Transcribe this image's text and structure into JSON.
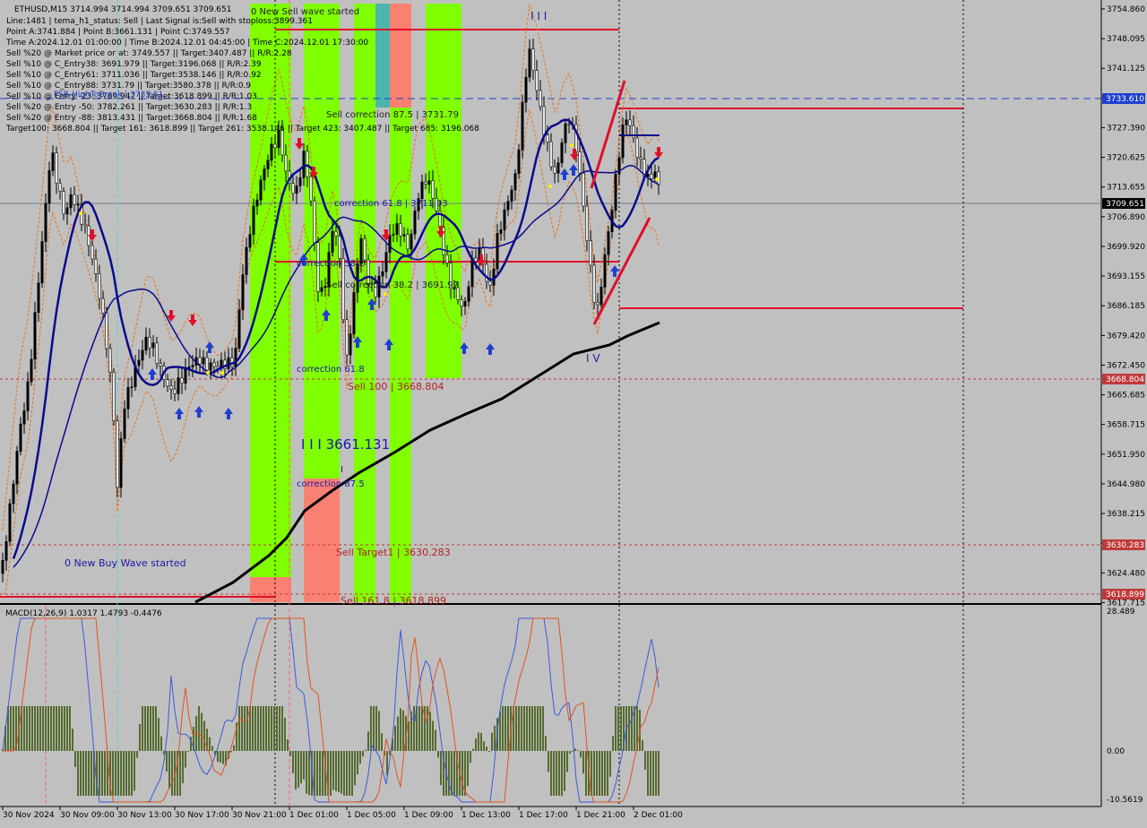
{
  "header": {
    "symbol_line": "ETHUSD,M15  3714.994 3714.994 3709.651 3709.651",
    "info_lines": [
      "Line:1481  |  tema_h1_status: Sell  |  Last Signal is:Sell with stoploss:3899.361",
      "Point A:3741.884  |  Point B:3661.131  |  Point C:3749.557",
      "Time A:2024.12.01 01:00:00  |  Time B:2024.12.01 04:45:00  |  Time C:2024.12.01 17:30:00",
      "Sell %20 @ Market price or at: 3749.557  ||  Target:3407.487  ||  R/R:2.28",
      "Sell %10 @ C_Entry38: 3691.979  ||  Target:3196.068  ||  R/R:2.39",
      "Sell %10 @ C_Entry61: 3711.036  ||  Target:3538.146  ||  R/R:0.92",
      "Sell %10 @ C_Entry88: 3731.79  ||  Target:3580.378  ||  R/R:0.9",
      "Sell %10 @ Entry -23: 3769.947  ||  Target:3618.899  ||  R/R:1.03",
      "Sell %20 @ Entry -50: 3782.261  ||  Target:3630.283  ||  R/R:1.3",
      "Sell %20 @ Entry -88: 3813.431  ||  Target:3668.804  ||  R/R:1.68",
      "Target100: 3668.804  ||  Target 161: 3618.899  ||  Target 261: 3538.146  ||  Target 423: 3407.487  ||  Target 685: 3196.068"
    ],
    "overlap_text": "FSB-HighToBreak  |  3733.61"
  },
  "price_axis": {
    "labels": [
      "3754.860",
      "3748.095",
      "3741.125",
      "3734.360",
      "3727.390",
      "3720.625",
      "3713.655",
      "3706.890",
      "3699.920",
      "3693.155",
      "3686.185",
      "3679.420",
      "3672.450",
      "3665.685",
      "3658.715",
      "3651.950",
      "3644.980",
      "3638.215",
      "3631.245",
      "3624.480",
      "3617.715"
    ],
    "tags": [
      {
        "text": "3733.610",
        "color": "#1f3fd0"
      },
      {
        "text": "3709.651",
        "color": "#000000"
      },
      {
        "text": "3668.804",
        "color": "#c03a3a"
      },
      {
        "text": "3630.283",
        "color": "#c03a3a"
      },
      {
        "text": "3618.899",
        "color": "#c03a3a"
      }
    ]
  },
  "macd": {
    "label": "MACD(12,26,9) 1.0317 1.4793 -0.4476",
    "scale_labels": [
      "28.489",
      "0.00",
      "-10.5619"
    ]
  },
  "time_axis": {
    "labels": [
      "30 Nov 2024",
      "30 Nov 09:00",
      "30 Nov 13:00",
      "30 Nov 17:00",
      "30 Nov 21:00",
      "1 Dec 01:00",
      "1 Dec 05:00",
      "1 Dec 09:00",
      "1 Dec 13:00",
      "1 Dec 17:00",
      "1 Dec 21:00",
      "2 Dec 01:00"
    ]
  },
  "annotations": {
    "new_sell_wave": "0 New Sell wave started",
    "new_buy_wave": "0 New Buy Wave started",
    "wave_iii_top": "I I I",
    "wave_iii_label": "I I I 3661.131",
    "wave_i": "I",
    "wave_iv": "I V",
    "sell_correction_875": "Sell correction 87.5 | 3731.79",
    "correction_618_mid": "correction 61.8 | 3711.03",
    "correction_382": "correction 38.2",
    "sell_correction_382": "Sell correction 38.2 | 3691.97",
    "correction_618": "correction 61.8",
    "correction_875": "correction 87.5",
    "sell_100": "Sell 100 | 3668.804",
    "sell_target1": "Sell Target1 | 3630.283",
    "sell_1618": "Sell 161.8 | 3618.899"
  },
  "colors": {
    "background": "#c0c0c0",
    "bullish_band": "#7fff00",
    "bearish_band": "#fa8072",
    "teal_band": "#4db6ac",
    "red_line": "#e0102a",
    "blue_line": "#1f3fd0",
    "ma_fast": "#0a0a8c",
    "ma_slow": "#000000"
  }
}
